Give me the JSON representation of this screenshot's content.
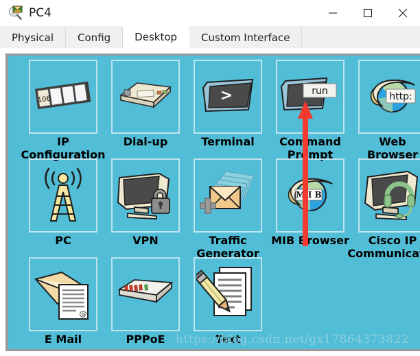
{
  "window": {
    "title": "PC4",
    "icon": "packet-tracer-envelope-magnifier-icon",
    "controls": {
      "minimize": "minimize-icon",
      "maximize": "maximize-icon",
      "close": "close-icon"
    }
  },
  "tabs": [
    {
      "label": "Physical",
      "active": false
    },
    {
      "label": "Config",
      "active": false
    },
    {
      "label": "Desktop",
      "active": true
    },
    {
      "label": "Custom Interface",
      "active": false
    }
  ],
  "desktop": {
    "background_color": "#52bdd6",
    "cell_border_color": "#bfe4ee",
    "items": [
      {
        "label_line1": "IP",
        "label_line2": "Configuration",
        "icon": "ip-configuration-icon",
        "badge": "106"
      },
      {
        "label_line1": "Dial-up",
        "label_line2": "",
        "icon": "dial-up-modem-icon",
        "badge": ""
      },
      {
        "label_line1": "Terminal",
        "label_line2": "",
        "icon": "terminal-icon",
        "badge": ">"
      },
      {
        "label_line1": "Command",
        "label_line2": "Prompt",
        "icon": "command-prompt-icon",
        "badge": "run"
      },
      {
        "label_line1": "Web",
        "label_line2": "Browser",
        "icon": "web-browser-icon",
        "badge": "http:"
      },
      {
        "label_line1": "PC",
        "label_line2": "",
        "icon": "pc-wireless-antenna-icon",
        "badge": ""
      },
      {
        "label_line1": "VPN",
        "label_line2": "",
        "icon": "vpn-monitor-lock-icon",
        "badge": ""
      },
      {
        "label_line1": "Traffic",
        "label_line2": "Generator",
        "icon": "traffic-generator-icon",
        "badge": ""
      },
      {
        "label_line1": "MIB Browser",
        "label_line2": "",
        "icon": "mib-browser-icon",
        "badge": "M I B"
      },
      {
        "label_line1": "Cisco IP",
        "label_line2": "Communicator",
        "icon": "cisco-ip-communicator-icon",
        "badge": ""
      },
      {
        "label_line1": "E Mail",
        "label_line2": "",
        "icon": "email-icon",
        "badge": "@"
      },
      {
        "label_line1": "PPPoE",
        "label_line2": "",
        "icon": "pppoe-device-icon",
        "badge": ""
      },
      {
        "label_line1": "Text",
        "label_line2": "",
        "icon": "text-editor-icon",
        "badge": ""
      }
    ]
  },
  "annotation": {
    "arrow": "red-up-arrow",
    "arrow_color": "#f23a30",
    "points_to": "Command Prompt"
  },
  "watermark": {
    "text": "https://blog.csdn.net/gx17864373822"
  }
}
